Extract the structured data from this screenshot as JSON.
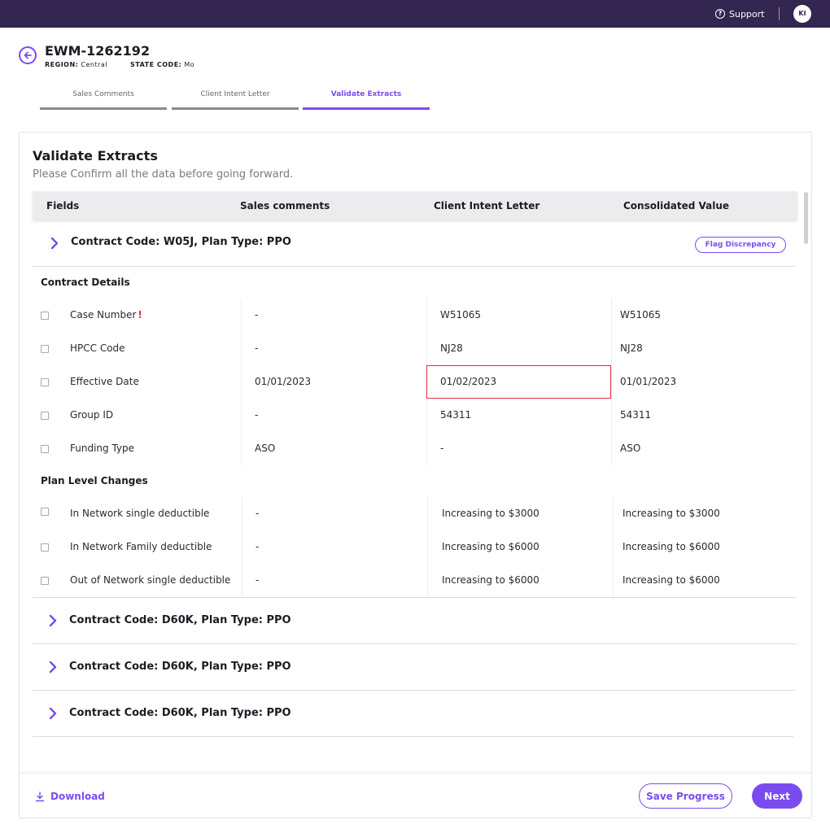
{
  "topbar": {
    "support_label": "Support",
    "support_icon": "help-circle-icon",
    "avatar_initials": "KI"
  },
  "header": {
    "back_icon": "arrow-left-circle-icon",
    "case_id": "EWM-1262192",
    "region_key": "REGION:",
    "region_value": "Central",
    "state_key": "STATE CODE:",
    "state_value": "Mo"
  },
  "tabs": [
    {
      "label": "Sales Comments",
      "active": false
    },
    {
      "label": "Client Intent Letter",
      "active": false
    },
    {
      "label": "Validate Extracts",
      "active": true
    }
  ],
  "card": {
    "title": "Validate Extracts",
    "subtitle": "Please Confirm all the data before going forward."
  },
  "table": {
    "headers": [
      "Fields",
      "Sales comments",
      "Client Intent Letter",
      "Consolidated Value"
    ]
  },
  "expanded_group": {
    "label": "Contract Code: W05J, Plan Type: PPO",
    "flag_button": "Flag Discrepancy",
    "sections": [
      {
        "title": "Contract Details",
        "rows": [
          {
            "field": "Case Number",
            "flag": "!",
            "sales": "-",
            "cil": "W51065",
            "consolidated": "W51065"
          },
          {
            "field": "HPCC Code",
            "sales": "-",
            "cil": "NJ28",
            "consolidated": "NJ28"
          },
          {
            "field": "Effective Date",
            "sales": "01/01/2023",
            "cil": "01/02/2023",
            "consolidated": "01/01/2023",
            "mismatch": true
          },
          {
            "field": "Group ID",
            "sales": "-",
            "cil": "54311",
            "consolidated": "54311"
          },
          {
            "field": "Funding Type",
            "sales": "ASO",
            "cil": "-",
            "consolidated": "ASO"
          }
        ]
      },
      {
        "title": "Plan Level Changes",
        "rows": [
          {
            "field": "In Network single deductible",
            "sales": "-",
            "cil": "Increasing to $3000",
            "consolidated": "Increasing to $3000"
          },
          {
            "field": "In Network Family deductible",
            "sales": "-",
            "cil": "Increasing to $6000",
            "consolidated": "Increasing to $6000"
          },
          {
            "field": "Out of Network single deductible",
            "sales": "-",
            "cil": "Increasing to $6000",
            "consolidated": "Increasing to $6000"
          }
        ]
      }
    ]
  },
  "collapsed_groups": [
    {
      "label": "Contract Code: D60K, Plan Type: PPO"
    },
    {
      "label": "Contract Code: D60K, Plan Type: PPO"
    },
    {
      "label": "Contract Code: D60K, Plan Type: PPO"
    }
  ],
  "footer": {
    "download_label": "Download",
    "download_icon": "download-icon",
    "save_label": "Save Progress",
    "next_label": "Next"
  },
  "colors": {
    "accent": "#7a4cf0",
    "topbar": "#332650",
    "error": "#e0303c"
  }
}
